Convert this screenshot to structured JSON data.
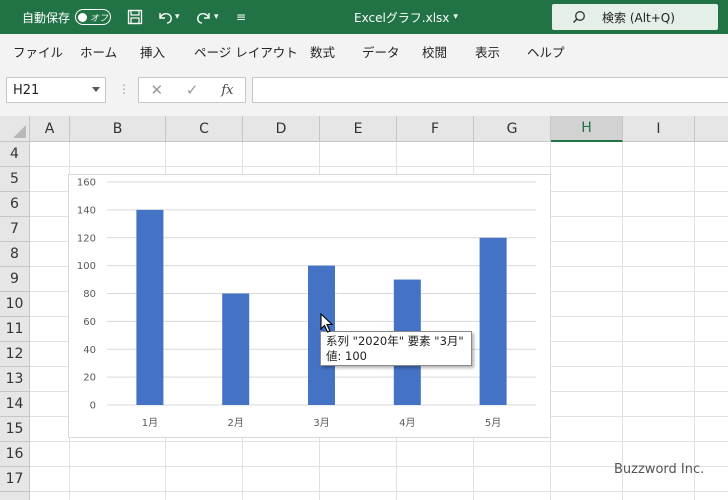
{
  "titlebar": {
    "autosave_label": "自動保存",
    "autosave_state": "オフ",
    "file_name": "Excelグラフ.xlsx",
    "search_label": "検索 (Alt+Q)",
    "bg_color": "#217346"
  },
  "ribbon": {
    "tabs": [
      "ファイル",
      "ホーム",
      "挿入",
      "ページ レイアウト",
      "数式",
      "データ",
      "校閲",
      "表示",
      "ヘルプ"
    ]
  },
  "formula_bar": {
    "name_box": "H21",
    "fx_label": "fx",
    "value": ""
  },
  "sheet": {
    "columns": [
      "A",
      "B",
      "C",
      "D",
      "E",
      "F",
      "G",
      "H",
      "I"
    ],
    "selected_column": "H",
    "rows": [
      "4",
      "5",
      "6",
      "7",
      "8",
      "9",
      "10",
      "11",
      "12",
      "13",
      "14",
      "15",
      "16",
      "17"
    ]
  },
  "chart_data": {
    "type": "bar",
    "categories": [
      "1月",
      "2月",
      "3月",
      "4月",
      "5月"
    ],
    "series": [
      {
        "name": "2020年",
        "values": [
          140,
          80,
          100,
          90,
          120
        ],
        "color": "#4472c4"
      }
    ],
    "ylim": [
      0,
      160
    ],
    "yticks": [
      0,
      20,
      40,
      60,
      80,
      100,
      120,
      140,
      160
    ],
    "grid": true,
    "title": "",
    "xlabel": "",
    "ylabel": ""
  },
  "tooltip": {
    "line1": "系列 \"2020年\" 要素 \"3月\"",
    "line2": "値: 100"
  },
  "watermark": "Buzzword Inc."
}
